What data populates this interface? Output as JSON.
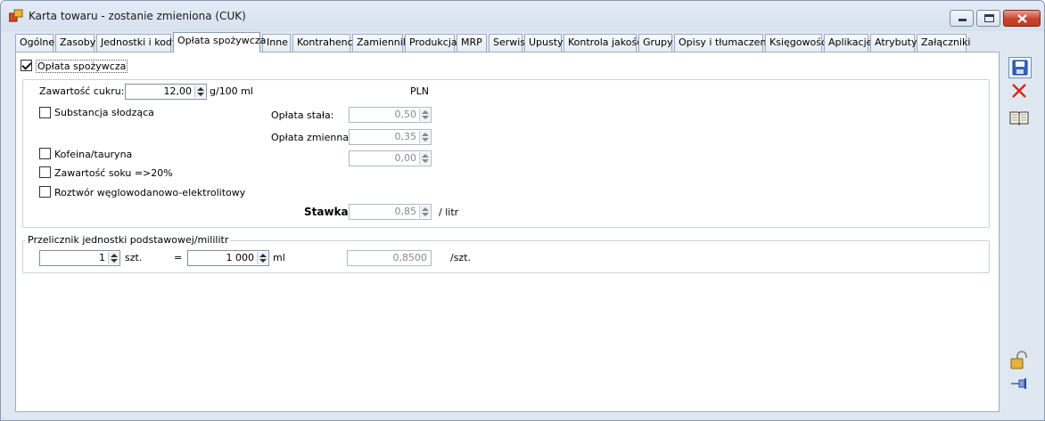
{
  "window": {
    "title": "Karta towaru - zostanie zmieniona (CUK)",
    "app_icon": "product-card-icon",
    "controls": {
      "minimize": "minimize-icon",
      "maximize": "maximize-icon",
      "close": "close-icon"
    }
  },
  "tabs": [
    {
      "label": "Ogólne"
    },
    {
      "label": "Zasoby"
    },
    {
      "label": "Jednostki i kody"
    },
    {
      "label": "Opłata spożywcza",
      "active": true
    },
    {
      "label": "Inne"
    },
    {
      "label": "Kontrahenci"
    },
    {
      "label": "Zamienniki"
    },
    {
      "label": "Produkcja"
    },
    {
      "label": "MRP"
    },
    {
      "label": "Serwis"
    },
    {
      "label": "Upusty"
    },
    {
      "label": "Kontrola jakości"
    },
    {
      "label": "Grupy"
    },
    {
      "label": "Opisy i tłumaczenia"
    },
    {
      "label": "Księgowość"
    },
    {
      "label": "Aplikacje"
    },
    {
      "label": "Atrybuty"
    },
    {
      "label": "Załączniki"
    }
  ],
  "fee": {
    "enabled_label": "Opłata spożywcza",
    "enabled": true,
    "sugar_label": "Zawartość cukru:",
    "sugar_value": "12,00",
    "sugar_unit": "g/100 ml",
    "currency": "PLN",
    "sweetener_label": "Substancja słodząca",
    "caffeine_label": "Kofeina/tauryna",
    "juice_label": "Zawartość soku =>20%",
    "electrolyte_label": "Roztwór węglowodanowo-elektrolitowy",
    "fixed_fee_label": "Opłata stała:",
    "fixed_fee_value": "0,50",
    "variable_fee_label": "Opłata zmienna:",
    "variable_fee_value": "0,35",
    "extra_fee_value": "0,00",
    "rate_label": "Stawka",
    "rate_value": "0,85",
    "rate_unit": "/ litr"
  },
  "converter": {
    "caption": "Przelicznik jednostki podstawowej/mililitr",
    "qty_value": "1",
    "qty_unit": "szt.",
    "equals": "=",
    "ml_value": "1 000",
    "ml_unit": "ml",
    "result_value": "0,8500",
    "result_unit": "/szt."
  },
  "toolbar": {
    "save": "save-icon",
    "cancel": "cancel-icon",
    "book": "book-icon",
    "lock": "lock-icon",
    "pin": "pin-icon"
  }
}
